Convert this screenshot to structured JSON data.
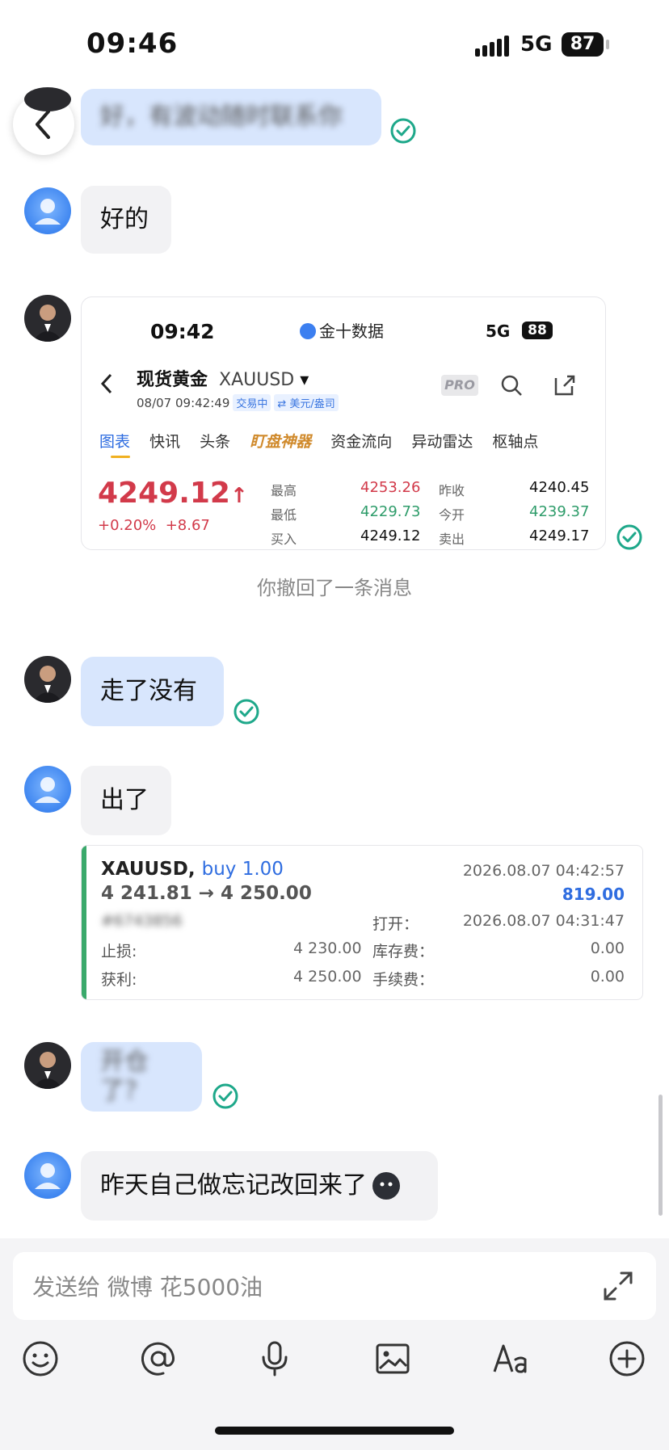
{
  "status_bar": {
    "time": "09:46",
    "network": "5G",
    "battery": "87"
  },
  "messages": [
    {
      "text": "好，有波动随时联系你"
    },
    {
      "text": "好的"
    },
    {
      "text": "走了没有"
    },
    {
      "text": "出了"
    },
    {
      "text": "开仓了？"
    },
    {
      "text": "昨天自己做忘记改回来了"
    }
  ],
  "screenshot": {
    "time": "09:42",
    "app_name": "金十数据",
    "network": "5G",
    "battery": "88",
    "title": "现货黄金",
    "symbol": "XAUUSD",
    "datetime": "08/07 09:42:49",
    "tag_trading": "交易中",
    "tag_unit": "⇄ 美元/盎司",
    "pro": "PRO",
    "tabs": [
      "图表",
      "快讯",
      "头条",
      "盯盘神器",
      "资金流向",
      "异动雷达",
      "枢轴点"
    ],
    "price": "4249.12",
    "price_arrow": "↑",
    "change_pct": "+0.20%",
    "change_abs": "+8.67",
    "quotes": {
      "high_label": "最高",
      "high": "4253.26",
      "prev_close_label": "昨收",
      "prev_close": "4240.45",
      "low_label": "最低",
      "low": "4229.73",
      "open_label": "今开",
      "open": "4239.37",
      "bid_label": "买入",
      "bid": "4249.12",
      "ask_label": "卖出",
      "ask": "4249.17"
    }
  },
  "recall_note": "你撤回了一条消息",
  "order": {
    "symbol": "XAUUSD,",
    "side": "buy 1.00",
    "prices": "4 241.81 → 4 250.00",
    "close_time": "2026.08.07 04:42:57",
    "profit": "819.00",
    "ticket": "#6743856",
    "open_label": "打开：",
    "open_time": "2026.08.07 04:31:47",
    "sl_label": "止损:",
    "sl": "4 230.00",
    "swap_label": "库存费：",
    "swap": "0.00",
    "tp_label": "获利:",
    "tp": "4 250.00",
    "fee_label": "手续费：",
    "fee": "0.00"
  },
  "composer": {
    "placeholder": "发送给 微博 花5000油"
  },
  "toolbar": [
    "emoji-icon",
    "mention-icon",
    "voice-icon",
    "image-icon",
    "text-format-icon",
    "plus-icon"
  ],
  "colors": {
    "accent": "#2f6de0",
    "check": "#1ea88a",
    "up": "#d23a4a",
    "down": "#2e9c6a"
  }
}
